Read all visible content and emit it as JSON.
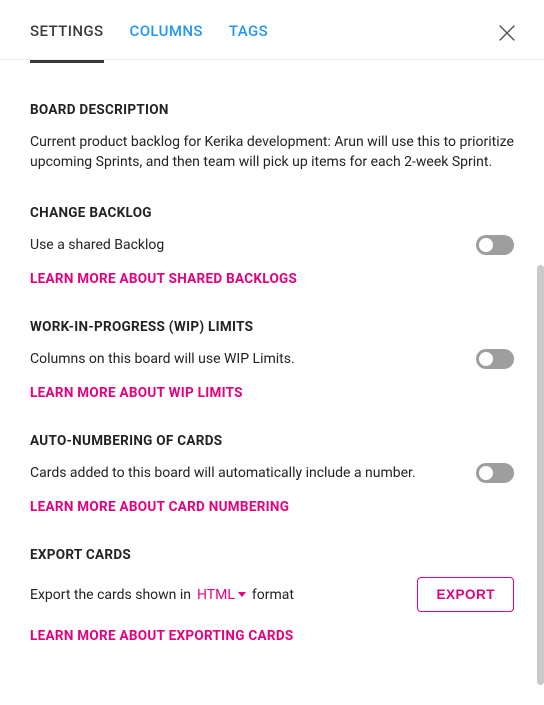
{
  "tabs": {
    "settings": "SETTINGS",
    "columns": "COLUMNS",
    "tags": "TAGS"
  },
  "sections": {
    "boardDescription": {
      "title": "BOARD DESCRIPTION",
      "text": "Current product backlog for Kerika development: Arun will use this to prioritize upcoming Sprints, and then team will pick up items for each 2-week Sprint."
    },
    "changeBacklog": {
      "title": "CHANGE BACKLOG",
      "text": "Use a shared Backlog",
      "learnMore": "LEARN MORE ABOUT SHARED BACKLOGS"
    },
    "wipLimits": {
      "title": "WORK-IN-PROGRESS (WIP) LIMITS",
      "text": "Columns on this board will use WIP Limits.",
      "learnMore": "LEARN MORE ABOUT WIP LIMITS"
    },
    "autoNumbering": {
      "title": "AUTO-NUMBERING OF CARDS",
      "text": "Cards added to this board will automatically include a number.",
      "learnMore": "LEARN MORE ABOUT CARD NUMBERING"
    },
    "exportCards": {
      "title": "EXPORT CARDS",
      "prefix": "Export the cards shown in",
      "format": "HTML",
      "suffix": "format",
      "button": "EXPORT",
      "learnMore": "LEARN MORE ABOUT EXPORTING CARDS"
    }
  }
}
